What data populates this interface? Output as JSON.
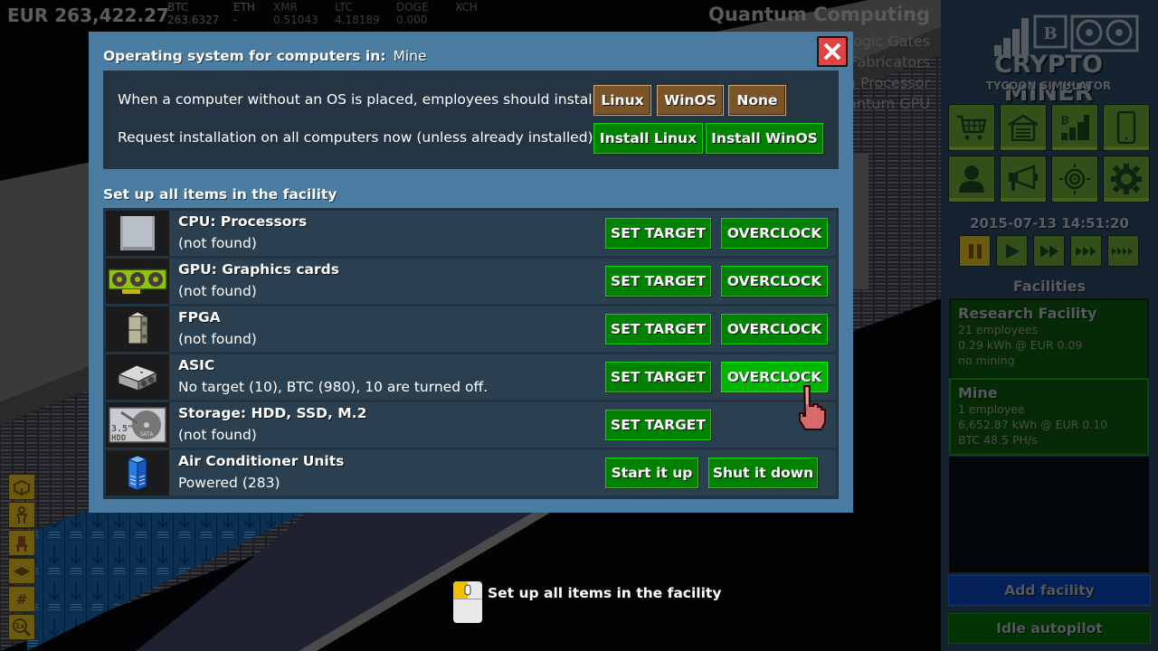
{
  "topbar": {
    "balance": "EUR 263,422.27",
    "coins": [
      {
        "symbol": "BTC",
        "value": "263.6327"
      },
      {
        "symbol": "ETH",
        "value": "-"
      },
      {
        "symbol": "XMR",
        "value": "0.51043"
      },
      {
        "symbol": "LTC",
        "value": "4.18189"
      },
      {
        "symbol": "DOGE",
        "value": "0.000"
      },
      {
        "symbol": "XCH",
        "value": ""
      }
    ],
    "research_title": "Quantum Computing",
    "research_items": [
      "Logic Gates",
      "Fabricators",
      "m Processor",
      "antum GPU"
    ]
  },
  "tools": [
    {
      "icon": "walls-icon"
    },
    {
      "icon": "employee-icon"
    },
    {
      "icon": "furniture-chair-icon"
    },
    {
      "icon": "floor-icon"
    },
    {
      "icon": "grid-icon",
      "glyph": "#"
    },
    {
      "icon": "zoom-1x-icon",
      "glyph": "1x"
    }
  ],
  "dialog": {
    "os_title": "Operating system for computers in:",
    "facility": "Mine",
    "default_install_label": "When a computer without an OS is placed, employees should install:",
    "default_options": [
      "Linux",
      "WinOS",
      "None"
    ],
    "request_label": "Request installation on all computers now (unless already installed):",
    "install_buttons": [
      "Install Linux",
      "Install WinOS"
    ],
    "items_title": "Set up all items in the facility",
    "items": [
      {
        "icon": "cpu-icon",
        "name": "CPU: Processors",
        "status": "(not found)",
        "buttons": [
          "SET TARGET",
          "OVERCLOCK"
        ]
      },
      {
        "icon": "gpu-icon",
        "name": "GPU: Graphics cards",
        "status": "(not found)",
        "buttons": [
          "SET TARGET",
          "OVERCLOCK"
        ]
      },
      {
        "icon": "fpga-icon",
        "name": "FPGA",
        "status": "(not found)",
        "buttons": [
          "SET TARGET",
          "OVERCLOCK"
        ]
      },
      {
        "icon": "asic-icon",
        "name": "ASIC",
        "status": "No target (10), BTC (980), 10 are turned off.",
        "buttons": [
          "SET TARGET",
          "OVERCLOCK"
        ]
      },
      {
        "icon": "hdd-icon",
        "name": "Storage: HDD, SSD, M.2",
        "status": "(not found)",
        "buttons": [
          "SET TARGET"
        ],
        "hdd_size": "3.5\"",
        "hdd_label": "HDD",
        "hdd_iface": "SATA"
      },
      {
        "icon": "air-conditioner-icon",
        "name": "Air Conditioner Units",
        "status": "Powered (283)",
        "buttons": [
          "Start it up",
          "Shut it down"
        ]
      }
    ]
  },
  "hint": {
    "text": "Set up all items in the facility"
  },
  "sidebar": {
    "logo_title": "CRYPTO MINER",
    "logo_subtitle": "TYCOON SIMULATOR",
    "logo_coin": "B",
    "menu": [
      {
        "icon": "shop-cart-icon"
      },
      {
        "icon": "facility-garage-icon"
      },
      {
        "icon": "bitcoin-stats-icon"
      },
      {
        "icon": "phone-icon"
      },
      {
        "icon": "employee-person-icon"
      },
      {
        "icon": "marketing-megaphone-icon"
      },
      {
        "icon": "target-crosshair-icon"
      },
      {
        "icon": "settings-gear-icon"
      }
    ],
    "datetime": "2015-07-13 14:51:20",
    "speed_buttons": [
      {
        "name": "pause",
        "active": true
      },
      {
        "name": "play-1x",
        "active": false
      },
      {
        "name": "play-2x",
        "active": false
      },
      {
        "name": "play-3x",
        "active": false
      },
      {
        "name": "play-4x",
        "active": false
      }
    ],
    "facilities_title": "Facilities",
    "facilities": [
      {
        "name": "Research Facility",
        "lines": [
          "21 employees",
          "0.29 kWh @ EUR 0.09",
          "no mining"
        ]
      },
      {
        "name": "Mine",
        "lines": [
          "1 employee",
          "6,652.87 kWh @ EUR 0.10",
          "BTC 48.5 PH/s"
        ]
      }
    ],
    "add_facility": "Add facility",
    "idle_autopilot": "Idle autopilot"
  },
  "colors": {
    "dialog_bg": "#4a7ba1",
    "panel_bg": "#243442",
    "green_button": "#008200",
    "brown_button": "#7b5528",
    "close_red": "#dd4444"
  }
}
